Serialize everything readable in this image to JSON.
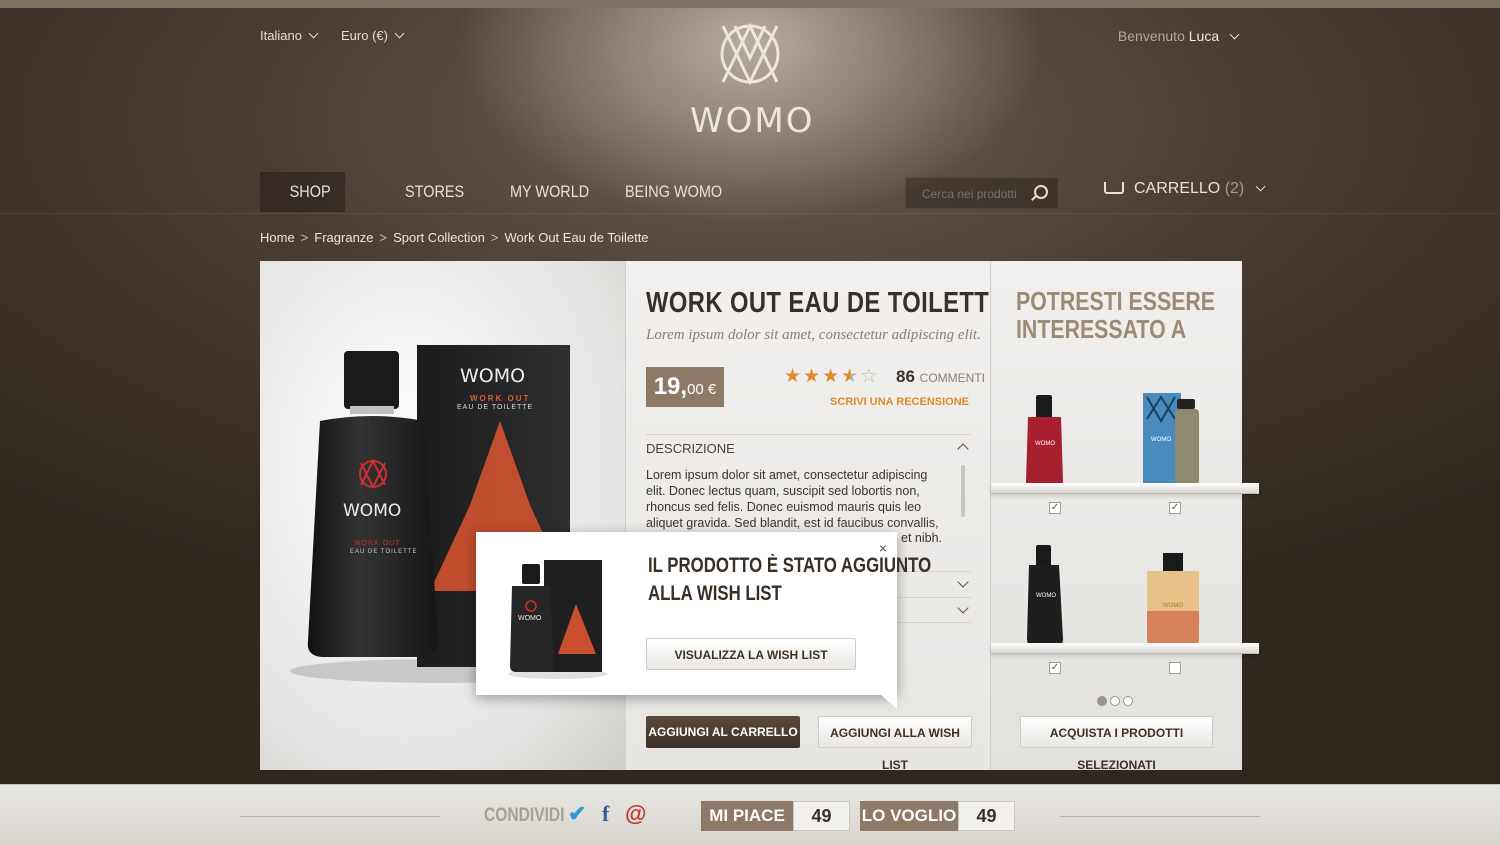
{
  "header": {
    "language": "Italiano",
    "currency": "Euro (€)",
    "welcome_prefix": "Benvenuto",
    "user_name": "Luca",
    "logo_text": "WOMO"
  },
  "nav": {
    "items": [
      "SHOP",
      "STORES",
      "MY WORLD",
      "BEING WOMO"
    ],
    "active": "SHOP",
    "search_placeholder": "Cerca nei prodotti",
    "cart_label": "CARRELLO",
    "cart_count": "(2)"
  },
  "breadcrumb": [
    "Home",
    "Fragranze",
    "Sport Collection",
    "Work Out Eau de Toilette"
  ],
  "product": {
    "title": "WORK OUT EAU DE TOILETTE",
    "subtitle": "Lorem ipsum dolor sit amet, consectetur adipiscing elit.",
    "price_main": "19,",
    "price_cents": "00 €",
    "rating": 3.5,
    "rating_max": 5,
    "comments_count": "86",
    "comments_label": "COMMENTI",
    "write_review": "SCRIVI UNA RECENSIONE",
    "description_heading": "DESCRIZIONE",
    "description_text": "Lorem ipsum dolor sit amet, consectetur adipiscing elit. Donec lectus quam, suscipit sed lobortis non, rhoncus sed felis. Donec euismod mauris quis leo aliquet gravida. Sed blandit, est id faucibus convallis, nunc",
    "description_tail": "et nibh.",
    "add_to_cart": "AGGIUNGI AL CARRELLO",
    "add_to_wishlist": "AGGIUNGI ALLA WISH LIST",
    "bottle_brand": "WOMO",
    "bottle_line": "WORK OUT",
    "bottle_type": "EAU DE TOILETTE",
    "box_brand": "WOMO",
    "box_line": "WORK OUT",
    "box_type": "EAU DE TOILETTE"
  },
  "sidebar": {
    "title_line1": "POTRESTI ESSERE",
    "title_line2": "INTERESSATO A",
    "products": [
      {
        "brand": "WOMO",
        "color": "#a8202e",
        "checked": true
      },
      {
        "brand": "WOMO",
        "color": "#4a8bbd",
        "checked": true
      },
      {
        "brand": "WOMO",
        "color": "#1e1e1e",
        "checked": true
      },
      {
        "brand": "WOMO",
        "color": "#e8c08a",
        "checked": false
      }
    ],
    "buy_selected": "ACQUISTA I PRODOTTI SELEZIONATI",
    "pages": 3,
    "current_page": 1
  },
  "popup": {
    "title_line1": "IL PRODOTTO È STATO AGGIUNTO",
    "title_line2": "ALLA WISH LIST",
    "button": "VISUALIZZA LA WISH LIST",
    "close": "×",
    "thumb_brand": "WOMO"
  },
  "footer": {
    "share_label": "CONDIVIDI",
    "likes_label": "MI PIACE",
    "likes_count": "49",
    "wants_label": "LO VOGLIO",
    "wants_count": "49"
  },
  "colors": {
    "accent": "#e08a2c",
    "brand_brown": "#8c7a67",
    "twitter": "#2f9bd6",
    "facebook": "#3b5998",
    "email": "#c0392b"
  }
}
